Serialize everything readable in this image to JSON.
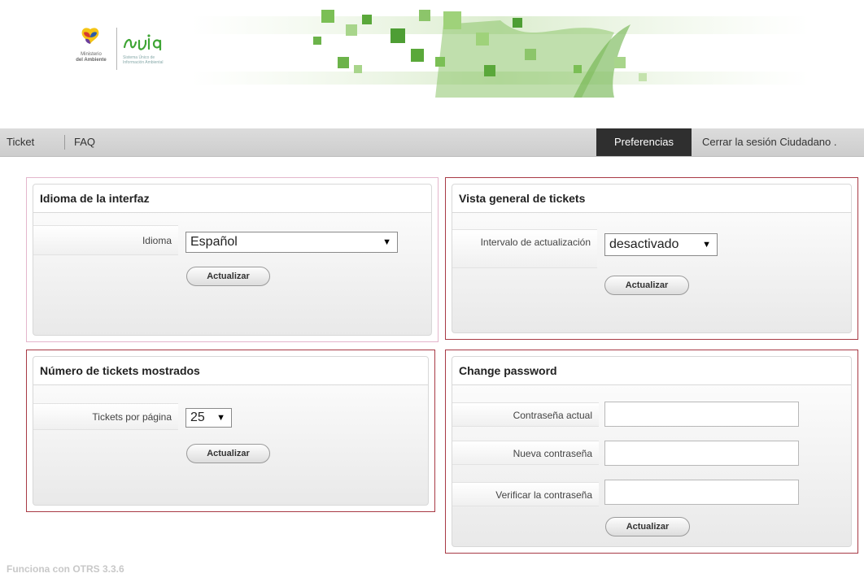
{
  "header": {
    "ministry_line1": "Ministerio",
    "ministry_line2": "del Ambiente",
    "suia_subtitle": "Sistema Único de Información Ambiental",
    "colors": {
      "green_dark": "#3fa535",
      "green_light": "#9fd27a"
    }
  },
  "nav": {
    "ticket_label": "Ticket",
    "faq_label": "FAQ",
    "preferences_label": "Preferencias",
    "logout_label": "Cerrar la sesión Ciudadano ."
  },
  "panels": {
    "language": {
      "title": "Idioma de la interfaz",
      "field_label": "Idioma",
      "selected_value": "Español",
      "button_label": "Actualizar"
    },
    "overview": {
      "title": "Vista general de tickets",
      "field_label": "Intervalo de actualización",
      "selected_value": "desactivado",
      "button_label": "Actualizar"
    },
    "tickets_shown": {
      "title": "Número de tickets mostrados",
      "field_label": "Tickets por página",
      "selected_value": "25",
      "button_label": "Actualizar"
    },
    "password": {
      "title": "Change password",
      "current_label": "Contraseña actual",
      "current_value": "",
      "new_label": "Nueva contraseña",
      "new_value": "",
      "verify_label": "Verificar la contraseña",
      "verify_value": "",
      "button_label": "Actualizar"
    }
  },
  "footer": {
    "text": "Funciona con OTRS 3.3.6"
  },
  "colors": {
    "panel_border": "#a83a45",
    "active_nav_bg": "#2f2f2f"
  }
}
